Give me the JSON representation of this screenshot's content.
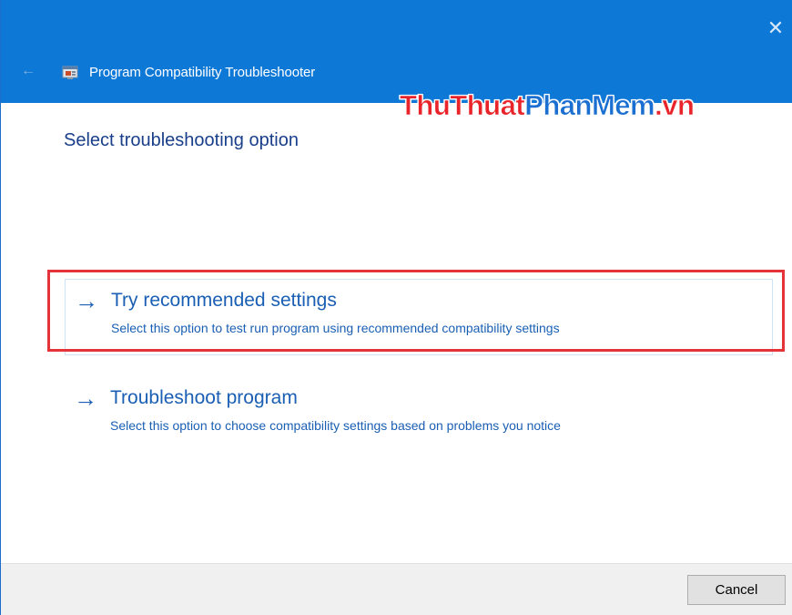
{
  "window": {
    "title": "Program Compatibility Troubleshooter",
    "close_icon": "close-icon",
    "back_icon": "back-arrow-icon",
    "accent_color": "#0e78d7"
  },
  "watermark": {
    "part1": "ThuThuat",
    "part2": "PhanMem",
    "part3": ".vn"
  },
  "main": {
    "heading": "Select troubleshooting option",
    "options": [
      {
        "title": "Try recommended settings",
        "description": "Select this option to test run program using recommended compatibility settings",
        "icon": "arrow-right-icon",
        "highlighted": true
      },
      {
        "title": "Troubleshoot program",
        "description": "Select this option to choose compatibility settings based on problems you notice",
        "icon": "arrow-right-icon",
        "highlighted": false
      }
    ]
  },
  "footer": {
    "cancel_label": "Cancel"
  },
  "annotation_color": "#e5333a"
}
